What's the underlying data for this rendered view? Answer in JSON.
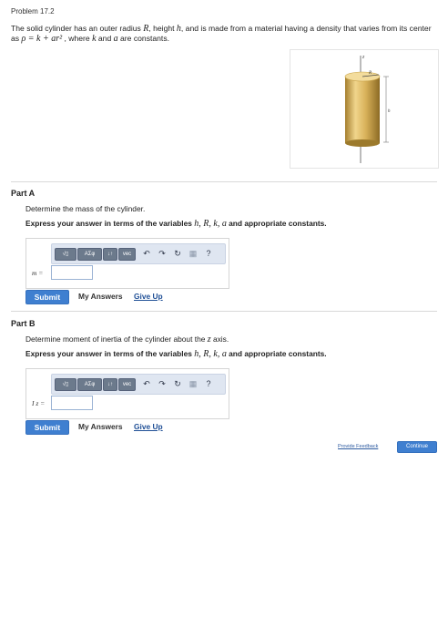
{
  "problem": {
    "title": "Problem 17.2",
    "statement": {
      "p1": "The solid cylinder has an outer radius ",
      "R": "R",
      "p2": ", height ",
      "h": "h",
      "p3": ", and is made from a material having a density that varies from its center as ",
      "formula": "ρ = k + ar²",
      "p4": " , where ",
      "k": "k",
      "p5": " and ",
      "a": "a",
      "p6": " are constants."
    },
    "figure": {
      "z_label": "z",
      "R_label": "R",
      "h_label": "h",
      "cylinder_color": "#d9b45a"
    }
  },
  "partA": {
    "title": "Part A",
    "prompt": "Determine the mass of the cylinder.",
    "instruction_text": "Express your answer in terms of the variables ",
    "instruction_vars": "h, R, k, a",
    "instruction_end": " and appropriate constants.",
    "answer_label": "m =",
    "answer_value": "",
    "submit": "Submit",
    "my_answers": "My Answers",
    "give_up": "Give Up"
  },
  "partB": {
    "title": "Part B",
    "prompt_text": "Determine moment of inertia of the cylinder about the ",
    "prompt_axis": "z",
    "prompt_end": " axis.",
    "instruction_text": "Express your answer in terms of the variables ",
    "instruction_vars": "h, R, k, a",
    "instruction_end": " and appropriate constants.",
    "answer_label": "I z =",
    "answer_value": "",
    "submit": "Submit",
    "my_answers": "My Answers",
    "give_up": "Give Up"
  },
  "toolbar": {
    "templates_label": "√▯",
    "symbols_label": "ΑΣφ",
    "updown_label": "↓↑",
    "vec_label": "vec",
    "undo": "↶",
    "redo": "↷",
    "reset": "↻",
    "keyboard": "▦",
    "help": "?"
  },
  "footer": {
    "provide_feedback": "Provide Feedback",
    "continue": "Continue"
  },
  "colors": {
    "accent": "#3f7fd0",
    "toolbar_bg": "#dfe6f1",
    "link": "#1f4f96"
  }
}
